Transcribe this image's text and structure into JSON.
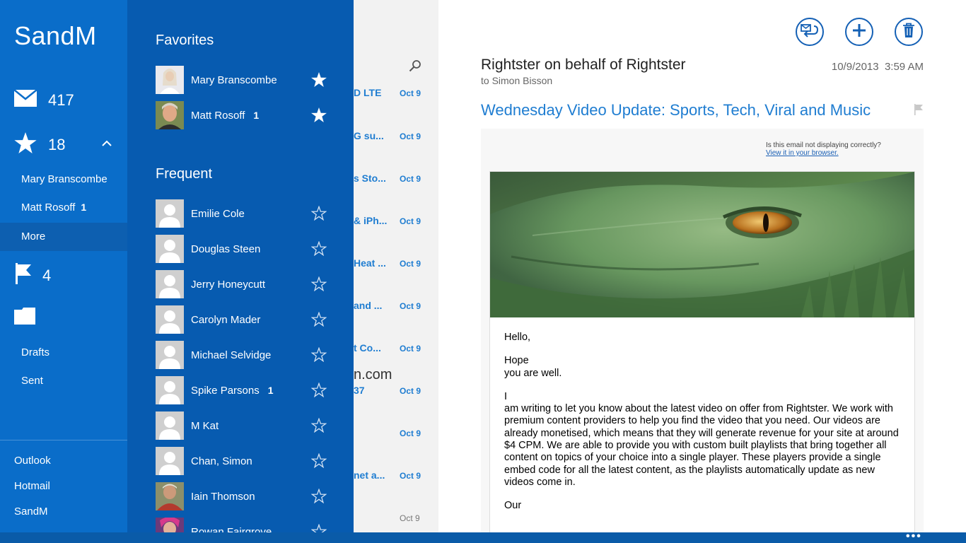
{
  "nav": {
    "account_name": "SandM",
    "inbox_count": "417",
    "favorites_count": "18",
    "favorites": [
      {
        "label": "Mary Branscombe",
        "badge": ""
      },
      {
        "label": "Matt Rosoff",
        "badge": "1"
      }
    ],
    "more_label": "More",
    "flagged_count": "4",
    "folders": [
      "Drafts",
      "Sent"
    ],
    "accounts": [
      "Outlook",
      "Hotmail",
      "SandM"
    ]
  },
  "flyout": {
    "favorites_title": "Favorites",
    "favorites": [
      {
        "name": "Mary Branscombe",
        "badge": "",
        "starred": true
      },
      {
        "name": "Matt Rosoff",
        "badge": "1",
        "starred": true
      }
    ],
    "frequent_title": "Frequent",
    "frequent": [
      {
        "name": "Emilie Cole",
        "badge": ""
      },
      {
        "name": "Douglas Steen",
        "badge": ""
      },
      {
        "name": "Jerry Honeycutt",
        "badge": ""
      },
      {
        "name": "Carolyn Mader",
        "badge": ""
      },
      {
        "name": "Michael Selvidge",
        "badge": ""
      },
      {
        "name": "Spike Parsons",
        "badge": "1"
      },
      {
        "name": "M Kat",
        "badge": ""
      },
      {
        "name": "Chan, Simon",
        "badge": ""
      },
      {
        "name": "Iain Thomson",
        "badge": ""
      },
      {
        "name": "Rowan Fairgrove",
        "badge": ""
      }
    ]
  },
  "message_list": {
    "items": [
      {
        "subject": "D LTE",
        "date": "Oct 9"
      },
      {
        "subject": "G su...",
        "date": "Oct 9"
      },
      {
        "subject": "s Sto...",
        "date": "Oct 9"
      },
      {
        "subject": "& iPh...",
        "date": "Oct 9"
      },
      {
        "subject": "Heat ...",
        "date": "Oct 9"
      },
      {
        "subject": "and ...",
        "date": "Oct 9"
      },
      {
        "subject": "t Co...",
        "date": "Oct 9"
      },
      {
        "subject": "37",
        "date": "Oct 9"
      },
      {
        "subject": "",
        "date": "Oct 9"
      },
      {
        "subject": "net a...",
        "date": "Oct 9"
      },
      {
        "subject": "",
        "date": "Oct 9"
      }
    ],
    "domain_fragment": "n.com"
  },
  "reading": {
    "from": "Rightster on behalf of Rightster",
    "to": "to Simon Bisson",
    "date": "10/9/2013",
    "time": "3:59 AM",
    "subject": "Wednesday Video Update: Sports, Tech, Viral and Music",
    "not_displaying": "Is this email not displaying correctly?",
    "view_in_browser": "View it in your browser.",
    "body": {
      "greeting": "Hello,",
      "p1": "Hope\n you are well.",
      "p2": "I\n am writing to let you know about the latest video on offer from Rightster. We work with premium content providers to help you find the video that you need. Our videos are already monetised, which means that they will generate revenue for your site at around\n $4 CPM. We are able to provide you with custom built playlists that bring together all content on topics of your choice into a single player. These players provide a single embed code for all the latest content, as the playlists automatically update as new\n videos come in.",
      "p3": "Our"
    }
  },
  "colors": {
    "nav_bg": "#0a6dc9",
    "flyout_bg": "#075bb0",
    "accent": "#1f7dd1",
    "command_button": "#1460b5"
  }
}
